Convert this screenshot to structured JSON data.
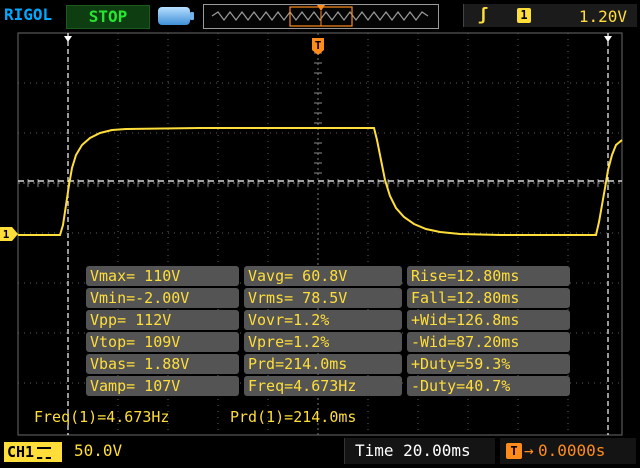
{
  "header": {
    "brand": "RIGOL",
    "run_state": "STOP",
    "trigger_channel": "1",
    "trigger_level": "1.20V"
  },
  "markers": {
    "trigger_position": "T",
    "ch1_ground": "1"
  },
  "measurements": {
    "rows": [
      [
        "Vmax= 110V",
        "Vavg= 60.8V",
        "Rise=12.80ms"
      ],
      [
        "Vmin=-2.00V",
        "Vrms= 78.5V",
        "Fall=12.80ms"
      ],
      [
        "Vpp= 112V",
        "Vovr=1.2%",
        "+Wid=126.8ms"
      ],
      [
        "Vtop= 109V",
        "Vpre=1.2%",
        "-Wid=87.20ms"
      ],
      [
        "Vbas= 1.88V",
        "Prd=214.0ms",
        "+Duty=59.3%"
      ],
      [
        "Vamp= 107V",
        "Freq=4.673Hz",
        "-Duty=40.7%"
      ]
    ]
  },
  "counters": {
    "freq": "Freq(1)=4.673Hz",
    "period": "Prd(1)=214.0ms"
  },
  "footer": {
    "channel_label": "CH1",
    "volts_per_div": "50.0V",
    "time_per_div": "Time 20.00ms",
    "trigger_offset": "0.0000s"
  },
  "colors": {
    "trace": "#ffde3a",
    "grid": "#6a6a6a",
    "run_state": "#27e530",
    "brand": "#00a8ff",
    "trigger_marker": "#ff8c1a"
  },
  "icons": {
    "battery": "battery-icon",
    "edge": "rising-edge-icon",
    "trigger": "trigger-marker-icon"
  }
}
